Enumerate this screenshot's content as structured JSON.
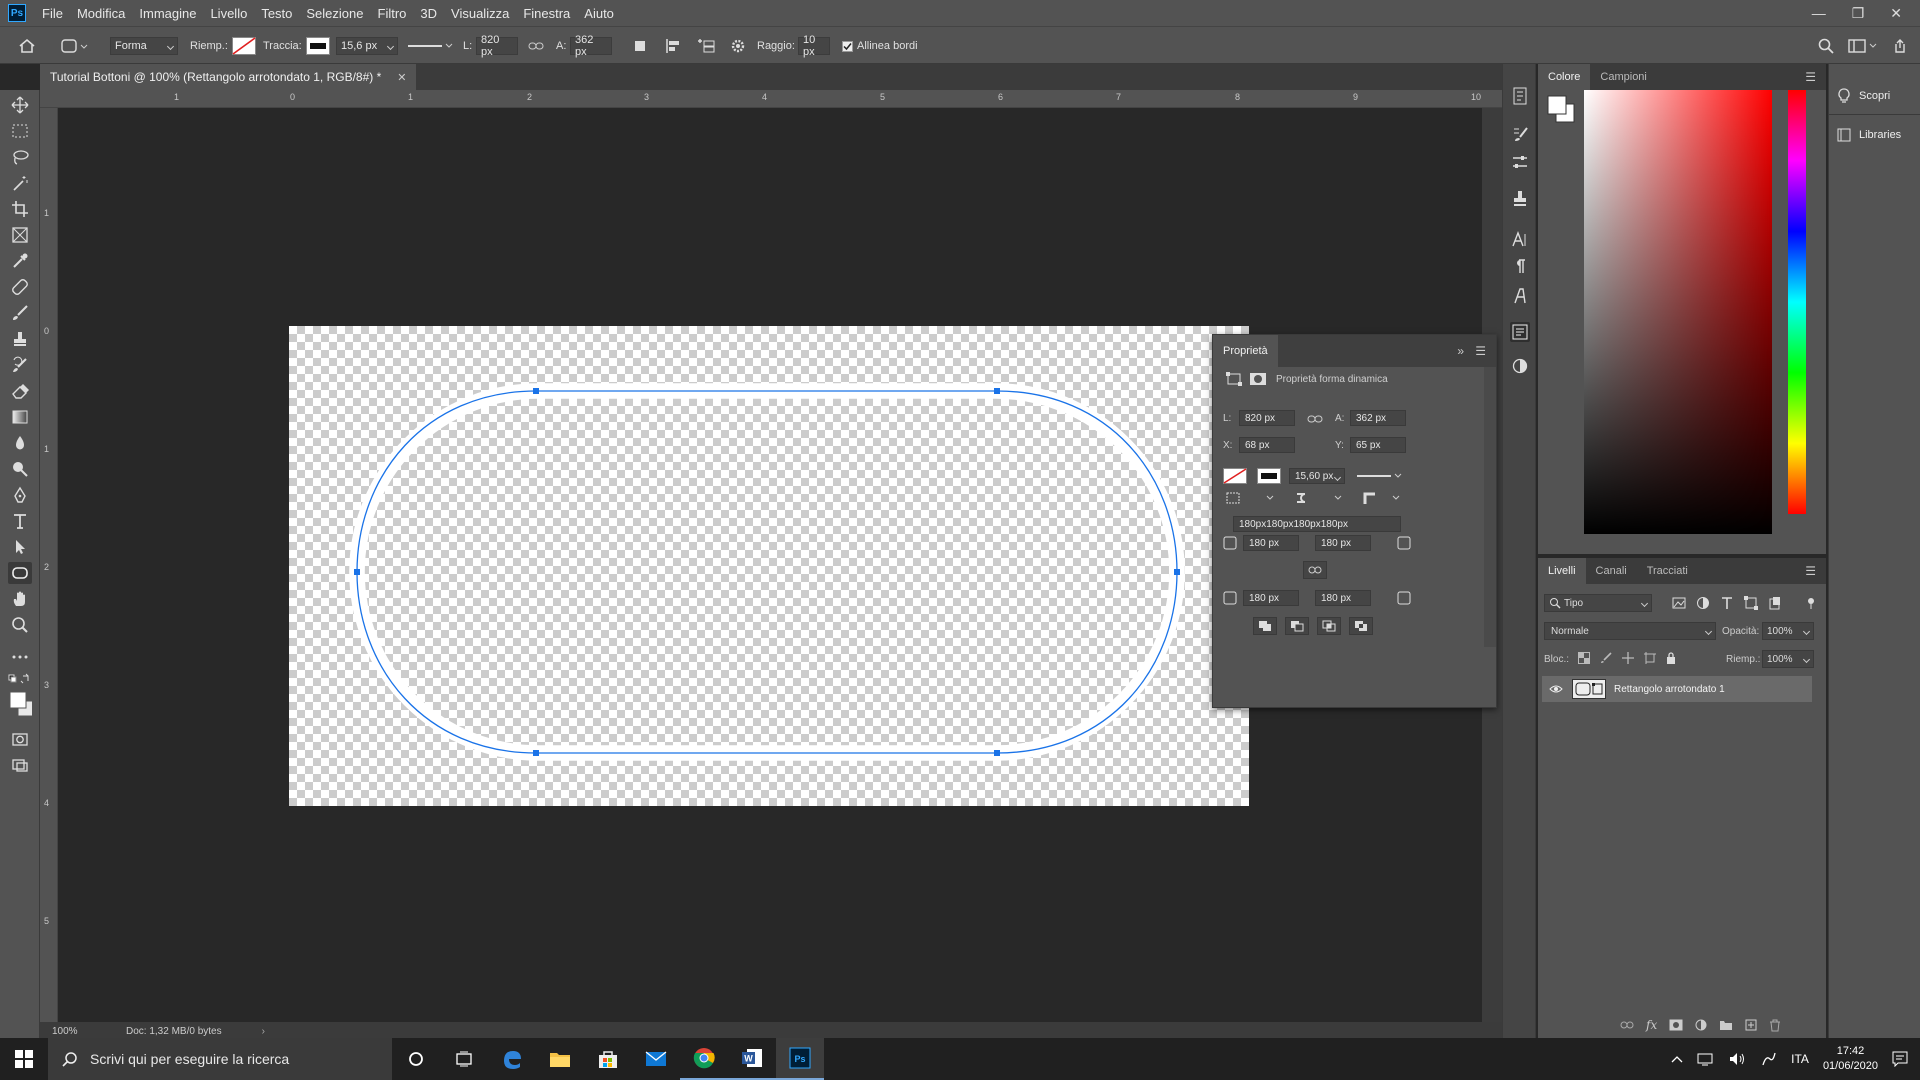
{
  "app": {
    "logo": "Ps"
  },
  "menu": [
    "File",
    "Modifica",
    "Immagine",
    "Livello",
    "Testo",
    "Selezione",
    "Filtro",
    "3D",
    "Visualizza",
    "Finestra",
    "Aiuto"
  ],
  "options": {
    "mode_value": "Forma",
    "fill_label": "Riemp.:",
    "stroke_label": "Traccia:",
    "stroke_width": "15,6 px",
    "w_label": "L:",
    "w_value": "820 px",
    "h_label": "A:",
    "h_value": "362 px",
    "radius_label": "Raggio:",
    "radius_value": "10 px",
    "align_edges_label": "Allinea bordi"
  },
  "document": {
    "tab_title": "Tutorial Bottoni @ 100% (Rettangolo arrotondato 1, RGB/8#) *",
    "zoom": "100%",
    "doc_info": "Doc: 1,32 MB/0 bytes"
  },
  "rulers": {
    "h_ticks": [
      "1",
      "0",
      "1",
      "2",
      "3",
      "4",
      "5",
      "6",
      "7",
      "8",
      "9",
      "10"
    ],
    "v_ticks": [
      "1",
      "0",
      "1",
      "2",
      "3",
      "4",
      "5"
    ]
  },
  "properties": {
    "title": "Proprietà",
    "subtitle": "Proprietà forma dinamica",
    "w_label": "L:",
    "w_value": "820 px",
    "h_label": "A:",
    "h_value": "362 px",
    "x_label": "X:",
    "x_value": "68 px",
    "y_label": "Y:",
    "y_value": "65 px",
    "stroke_width": "15,60 px",
    "corner_summary": "180px180px180px180px",
    "corner_tl": "180 px",
    "corner_tr": "180 px",
    "corner_bl": "180 px",
    "corner_br": "180 px"
  },
  "color_panel": {
    "tabs": [
      "Colore",
      "Campioni"
    ],
    "active_tab": 0
  },
  "layers_panel": {
    "tabs": [
      "Livelli",
      "Canali",
      "Tracciati"
    ],
    "filter_label": "Tipo",
    "blend_mode": "Normale",
    "opacity_label": "Opacità:",
    "opacity_value": "100%",
    "lock_label": "Bloc.:",
    "fill_label": "Riemp.:",
    "fill_value": "100%",
    "layers": [
      {
        "name": "Rettangolo arrotondato 1"
      }
    ]
  },
  "right_column": {
    "discover": "Scopri",
    "libraries": "Libraries"
  },
  "taskbar": {
    "search_placeholder": "Scrivi qui per eseguire la ricerca",
    "lang": "ITA",
    "time": "17:42",
    "date": "01/06/2020"
  },
  "colors": {
    "path_blue": "#1a73e8",
    "ps_blue": "#31a8ff"
  }
}
